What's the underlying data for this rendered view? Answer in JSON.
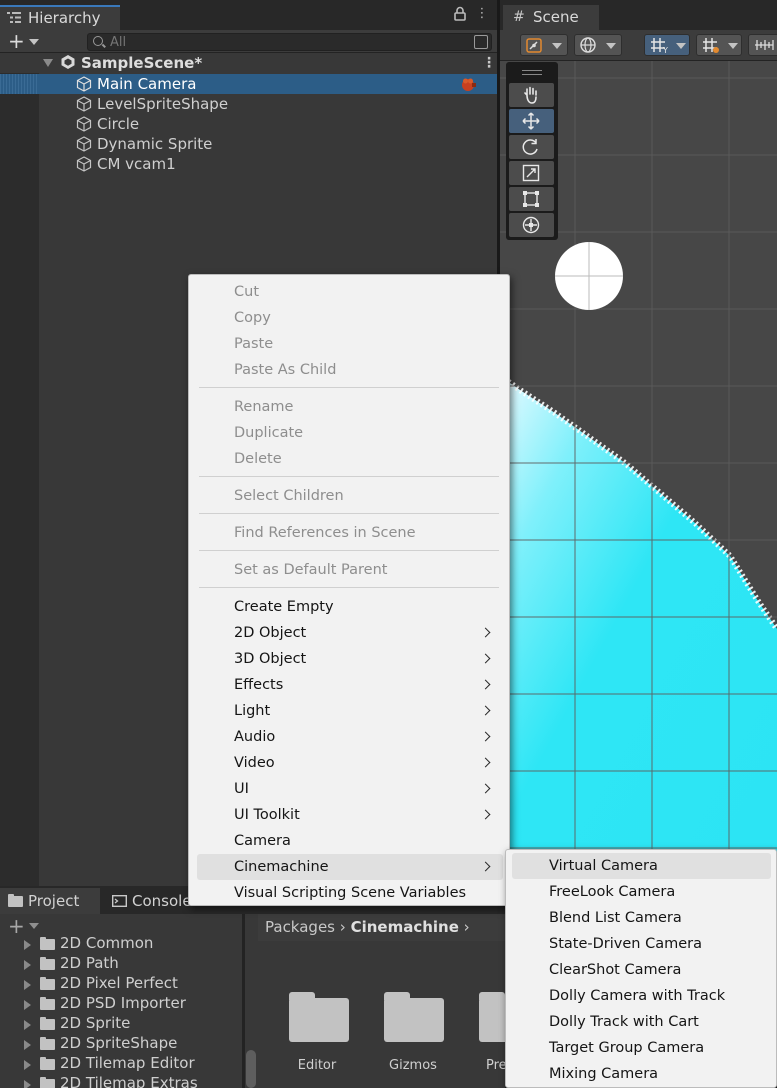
{
  "hierarchy": {
    "tab_label": "Hierarchy",
    "search_placeholder": "All",
    "scene_name": "SampleScene*",
    "items": [
      {
        "label": "Main Camera"
      },
      {
        "label": "LevelSpriteShape"
      },
      {
        "label": "Circle"
      },
      {
        "label": "Dynamic Sprite"
      },
      {
        "label": "CM vcam1"
      }
    ]
  },
  "scene": {
    "tab_label": "Scene"
  },
  "bottom": {
    "tabs": [
      {
        "label": "Project"
      },
      {
        "label": "Console"
      }
    ],
    "packages": [
      {
        "label": "2D Common"
      },
      {
        "label": "2D Path"
      },
      {
        "label": "2D Pixel Perfect"
      },
      {
        "label": "2D PSD Importer"
      },
      {
        "label": "2D Sprite"
      },
      {
        "label": "2D SpriteShape"
      },
      {
        "label": "2D Tilemap Editor"
      },
      {
        "label": "2D Tilemap Extras"
      }
    ],
    "breadcrumb": {
      "root": "Packages",
      "current": "Cinemachine"
    },
    "folders": [
      {
        "label": "Editor"
      },
      {
        "label": "Gizmos"
      },
      {
        "label": "Pre"
      }
    ]
  },
  "context_menu": {
    "items": [
      {
        "label": "Cut",
        "enabled": false
      },
      {
        "label": "Copy",
        "enabled": false
      },
      {
        "label": "Paste",
        "enabled": false
      },
      {
        "label": "Paste As Child",
        "enabled": false
      },
      {
        "label": "Rename",
        "enabled": false
      },
      {
        "label": "Duplicate",
        "enabled": false
      },
      {
        "label": "Delete",
        "enabled": false
      },
      {
        "label": "Select Children",
        "enabled": false
      },
      {
        "label": "Find References in Scene",
        "enabled": false
      },
      {
        "label": "Set as Default Parent",
        "enabled": false
      },
      {
        "label": "Create Empty",
        "enabled": true
      },
      {
        "label": "2D Object",
        "enabled": true,
        "submenu": true
      },
      {
        "label": "3D Object",
        "enabled": true,
        "submenu": true
      },
      {
        "label": "Effects",
        "enabled": true,
        "submenu": true
      },
      {
        "label": "Light",
        "enabled": true,
        "submenu": true
      },
      {
        "label": "Audio",
        "enabled": true,
        "submenu": true
      },
      {
        "label": "Video",
        "enabled": true,
        "submenu": true
      },
      {
        "label": "UI",
        "enabled": true,
        "submenu": true
      },
      {
        "label": "UI Toolkit",
        "enabled": true,
        "submenu": true
      },
      {
        "label": "Camera",
        "enabled": true
      },
      {
        "label": "Cinemachine",
        "enabled": true,
        "submenu": true,
        "highlighted": true
      },
      {
        "label": "Visual Scripting Scene Variables",
        "enabled": true
      }
    ]
  },
  "submenu": {
    "items": [
      {
        "label": "Virtual Camera",
        "highlighted": true
      },
      {
        "label": "FreeLook Camera"
      },
      {
        "label": "Blend List Camera"
      },
      {
        "label": "State-Driven Camera"
      },
      {
        "label": "ClearShot Camera"
      },
      {
        "label": "Dolly Camera with Track"
      },
      {
        "label": "Dolly Track with Cart"
      },
      {
        "label": "Target Group Camera"
      },
      {
        "label": "Mixing Camera"
      }
    ]
  },
  "colors": {
    "selection": "#2c5d87",
    "menu_bg": "#f2f2f2",
    "water": "#2ee6f5",
    "accent_tab": "#3a79bb"
  }
}
